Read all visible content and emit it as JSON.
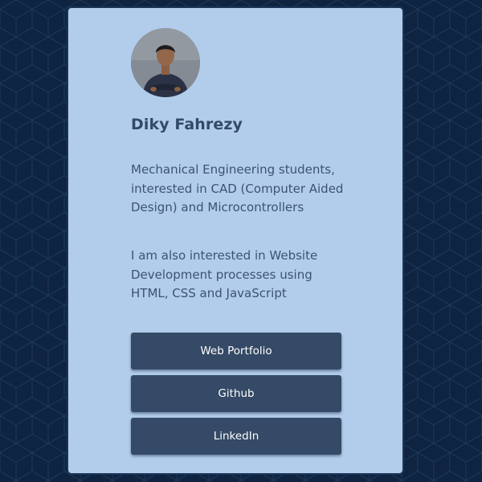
{
  "profile": {
    "name": "Diky Fahrezy",
    "bio": [
      "Mechanical Engineering students, interested in CAD (Computer Aided Design) and Microcontrollers",
      "I am also interested in Website Development processes using HTML, CSS and JavaScript"
    ]
  },
  "links": [
    {
      "label": "Web Portfolio"
    },
    {
      "label": "Github"
    },
    {
      "label": "LinkedIn"
    }
  ],
  "colors": {
    "page_background": "#0f2440",
    "card_background": "#b2cdec",
    "button_background": "#344a66",
    "name_text": "#334a67",
    "body_text": "#3c5272"
  }
}
